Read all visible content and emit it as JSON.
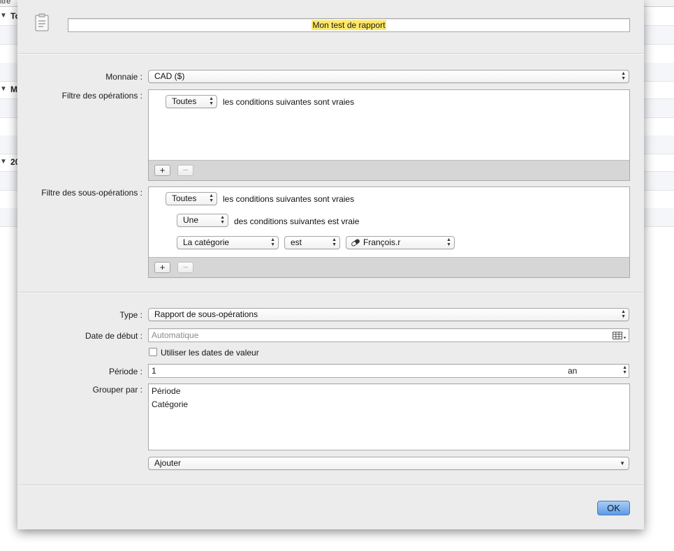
{
  "background": {
    "header_label": "itre",
    "rows": [
      {
        "label": "To"
      },
      {
        "label": "M"
      },
      {
        "label": "20"
      }
    ]
  },
  "sheet": {
    "report_title": "Mon test de rapport",
    "currency": {
      "label": "Monnaie :",
      "value": "CAD ($)"
    },
    "transaction_filter": {
      "label": "Filtre des opérations :",
      "match": "Toutes",
      "match_text": "les conditions suivantes sont vraies",
      "add": "+",
      "remove": "−"
    },
    "split_filter": {
      "label": "Filtre des sous-opérations :",
      "match": "Toutes",
      "match_text": "les conditions suivantes sont vraies",
      "sub_match": "Une",
      "sub_match_text": "des conditions suivantes est vraie",
      "rule_field": "La catégorie",
      "rule_operator": "est",
      "rule_value": "François.r",
      "add": "+",
      "remove": "−"
    },
    "type": {
      "label": "Type :",
      "value": "Rapport de sous-opérations"
    },
    "start_date": {
      "label": "Date de début :",
      "placeholder": "Automatique"
    },
    "value_dates": {
      "label": "Utiliser les dates de valeur",
      "checked": false
    },
    "period": {
      "label": "Période :",
      "value": "1",
      "unit": "an"
    },
    "group_by": {
      "label": "Grouper par :",
      "items": [
        "Période",
        "Catégorie"
      ]
    },
    "add_group": "Ajouter",
    "ok": "OK"
  },
  "colors": {
    "highlight": "#ffe866",
    "default_button": "#6aa3e8"
  }
}
